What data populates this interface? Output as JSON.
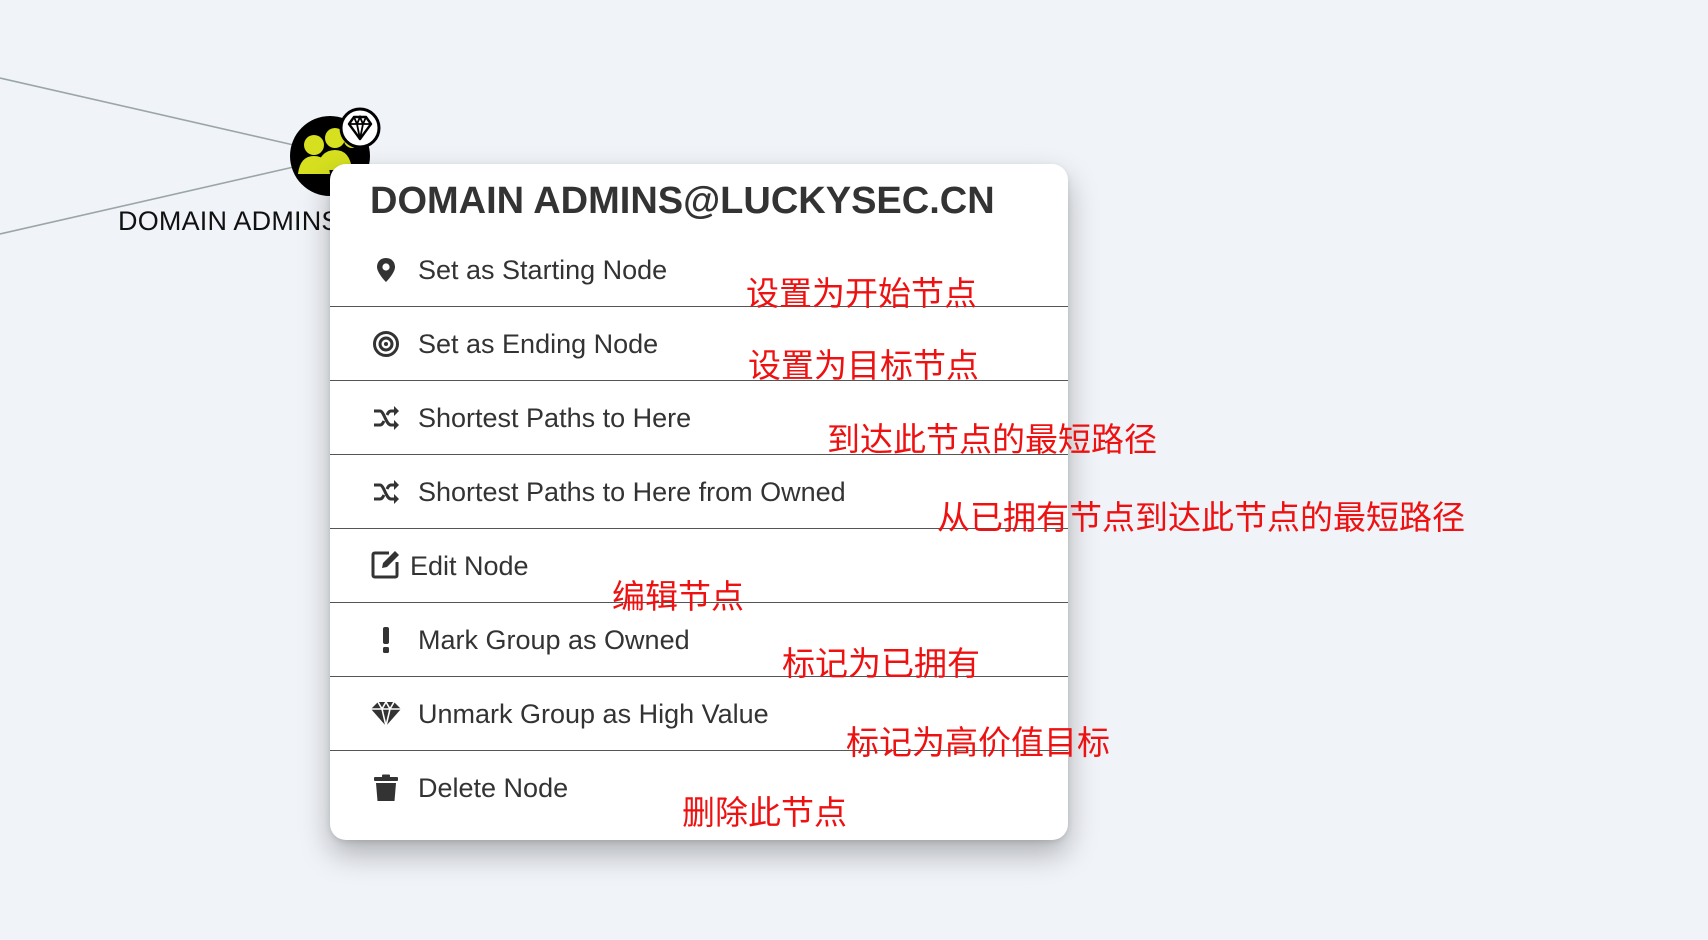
{
  "graph": {
    "node_label": "DOMAIN ADMINS@LUCKYSEC.CN",
    "node_icon": "group-icon",
    "node_badge_icon": "diamond-icon",
    "node_color": "#d6e01f"
  },
  "context_menu": {
    "title": "DOMAIN ADMINS@LUCKYSEC.CN",
    "items": [
      {
        "label": "Set as Starting Node",
        "icon": "map-marker-icon"
      },
      {
        "label": "Set as Ending Node",
        "icon": "bullseye-icon"
      },
      {
        "label": "Shortest Paths to Here",
        "icon": "random-icon"
      },
      {
        "label": "Shortest Paths to Here from Owned",
        "icon": "random-icon"
      },
      {
        "label": "Edit Node",
        "icon": "edit-icon"
      },
      {
        "label": "Mark Group as Owned",
        "icon": "exclamation-icon"
      },
      {
        "label": "Unmark Group as High Value",
        "icon": "gem-icon"
      },
      {
        "label": "Delete Node",
        "icon": "trash-icon"
      }
    ]
  },
  "annotations": [
    "设置为开始节点",
    "设置为目标节点",
    "到达此节点的最短路径",
    "从已拥有节点到达此节点的最短路径",
    "编辑节点",
    "标记为已拥有",
    "标记为高价值目标",
    "删除此节点"
  ],
  "colors": {
    "background": "#f0f3f8",
    "annotation": "#ee1111",
    "menu_text": "#333333"
  }
}
